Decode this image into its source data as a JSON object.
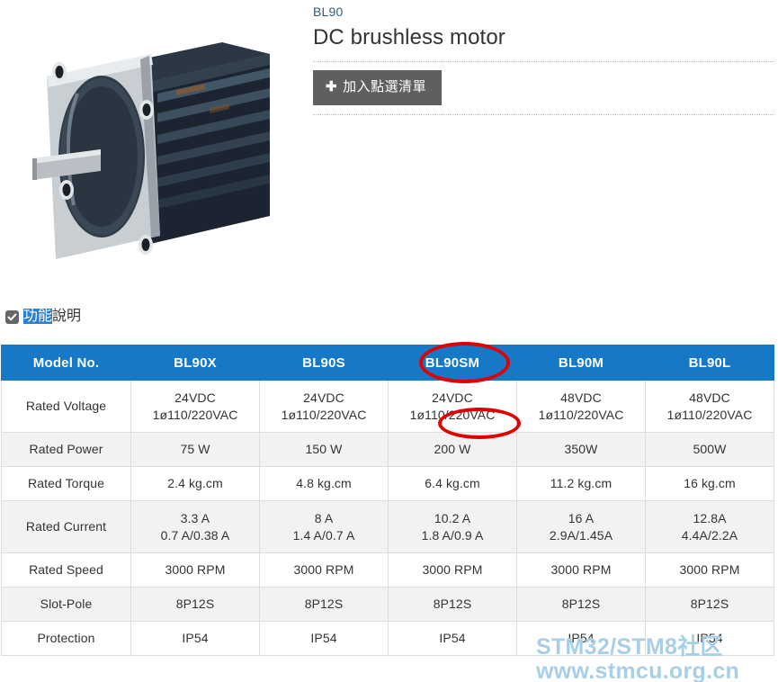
{
  "product": {
    "sku": "BL90",
    "title": "DC brushless motor",
    "add_button_label": "加入點選清單",
    "plus_glyph": "✚",
    "photo_alt": "dc-brushless-motor-photo"
  },
  "section": {
    "checkbox_icon": "checkbox-checked-icon",
    "title_highlighted": "功能",
    "title_rest": "說明"
  },
  "table": {
    "headers": [
      "Model No.",
      "BL90X",
      "BL90S",
      "BL90SM",
      "BL90M",
      "BL90L"
    ],
    "rows": [
      {
        "label": "Rated Voltage",
        "shaded": false,
        "tall": true,
        "cells": [
          {
            "line1": "24VDC",
            "line2": "1ø110/220VAC"
          },
          {
            "line1": "24VDC",
            "line2": "1ø110/220VAC"
          },
          {
            "line1": "24VDC",
            "line2": "1ø110/220VAC"
          },
          {
            "line1": "48VDC",
            "line2": "1ø110/220VAC"
          },
          {
            "line1": "48VDC",
            "line2": "1ø110/220VAC"
          }
        ]
      },
      {
        "label": "Rated Power",
        "shaded": true,
        "tall": false,
        "cells": [
          {
            "line1": "75 W",
            "line2": ""
          },
          {
            "line1": "150 W",
            "line2": ""
          },
          {
            "line1": "200 W",
            "line2": ""
          },
          {
            "line1": "350W",
            "line2": ""
          },
          {
            "line1": "500W",
            "line2": ""
          }
        ]
      },
      {
        "label": "Rated Torque",
        "shaded": false,
        "tall": false,
        "cells": [
          {
            "line1": "2.4 kg.cm",
            "line2": ""
          },
          {
            "line1": "4.8 kg.cm",
            "line2": ""
          },
          {
            "line1": "6.4 kg.cm",
            "line2": ""
          },
          {
            "line1": "11.2 kg.cm",
            "line2": ""
          },
          {
            "line1": "16 kg.cm",
            "line2": ""
          }
        ]
      },
      {
        "label": "Rated Current",
        "shaded": true,
        "tall": true,
        "cells": [
          {
            "line1": "3.3 A",
            "line2": "0.7 A/0.38 A"
          },
          {
            "line1": "8 A",
            "line2": "1.4 A/0.7 A"
          },
          {
            "line1": "10.2 A",
            "line2": "1.8 A/0.9 A"
          },
          {
            "line1": "16 A",
            "line2": "2.9A/1.45A"
          },
          {
            "line1": "12.8A",
            "line2": "4.4A/2.2A"
          }
        ]
      },
      {
        "label": "Rated Speed",
        "shaded": false,
        "tall": false,
        "cells": [
          {
            "line1": "3000 RPM",
            "line2": ""
          },
          {
            "line1": "3000 RPM",
            "line2": ""
          },
          {
            "line1": "3000 RPM",
            "line2": ""
          },
          {
            "line1": "3000 RPM",
            "line2": ""
          },
          {
            "line1": "3000 RPM",
            "line2": ""
          }
        ]
      },
      {
        "label": "Slot-Pole",
        "shaded": true,
        "tall": false,
        "cells": [
          {
            "line1": "8P12S",
            "line2": ""
          },
          {
            "line1": "8P12S",
            "line2": ""
          },
          {
            "line1": "8P12S",
            "line2": ""
          },
          {
            "line1": "8P12S",
            "line2": ""
          },
          {
            "line1": "8P12S",
            "line2": ""
          }
        ]
      },
      {
        "label": "Protection",
        "shaded": false,
        "tall": false,
        "cells": [
          {
            "line1": "IP54",
            "line2": ""
          },
          {
            "line1": "IP54",
            "line2": ""
          },
          {
            "line1": "IP54",
            "line2": ""
          },
          {
            "line1": "IP54",
            "line2": ""
          },
          {
            "line1": "IP54",
            "line2": ""
          }
        ]
      }
    ]
  },
  "annotations": [
    {
      "name": "red-ellipse-model-bl90sm",
      "target": "BL90SM"
    },
    {
      "name": "red-ellipse-voltage-220vac",
      "target": "220VAC"
    }
  ],
  "watermark": {
    "line1": "STM32/STM8社区",
    "line2": "www.stmcu.org.cn"
  },
  "colors": {
    "header_blue": "#1878c8",
    "annotation_red": "#e00000",
    "button_gray": "#5f5f5f",
    "row_shade": "#f2f2f2",
    "sku_blue": "#2c5d79",
    "watermark_blue": "#a8cfe8",
    "highlight_blue": "#2a7fd4"
  }
}
